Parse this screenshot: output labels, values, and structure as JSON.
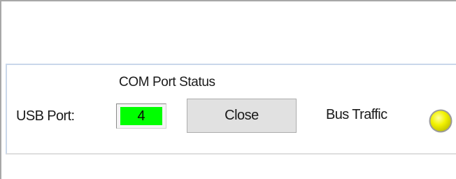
{
  "com_status": {
    "title": "COM Port Status",
    "usb_port_label": "USB Port:",
    "port_number": "4",
    "port_indicator_color": "#00ff00",
    "close_button_label": "Close",
    "bus_traffic_label": "Bus Traffic",
    "bus_traffic_led": "yellow-indicator-light",
    "bus_traffic_led_color": "#f2f200"
  }
}
